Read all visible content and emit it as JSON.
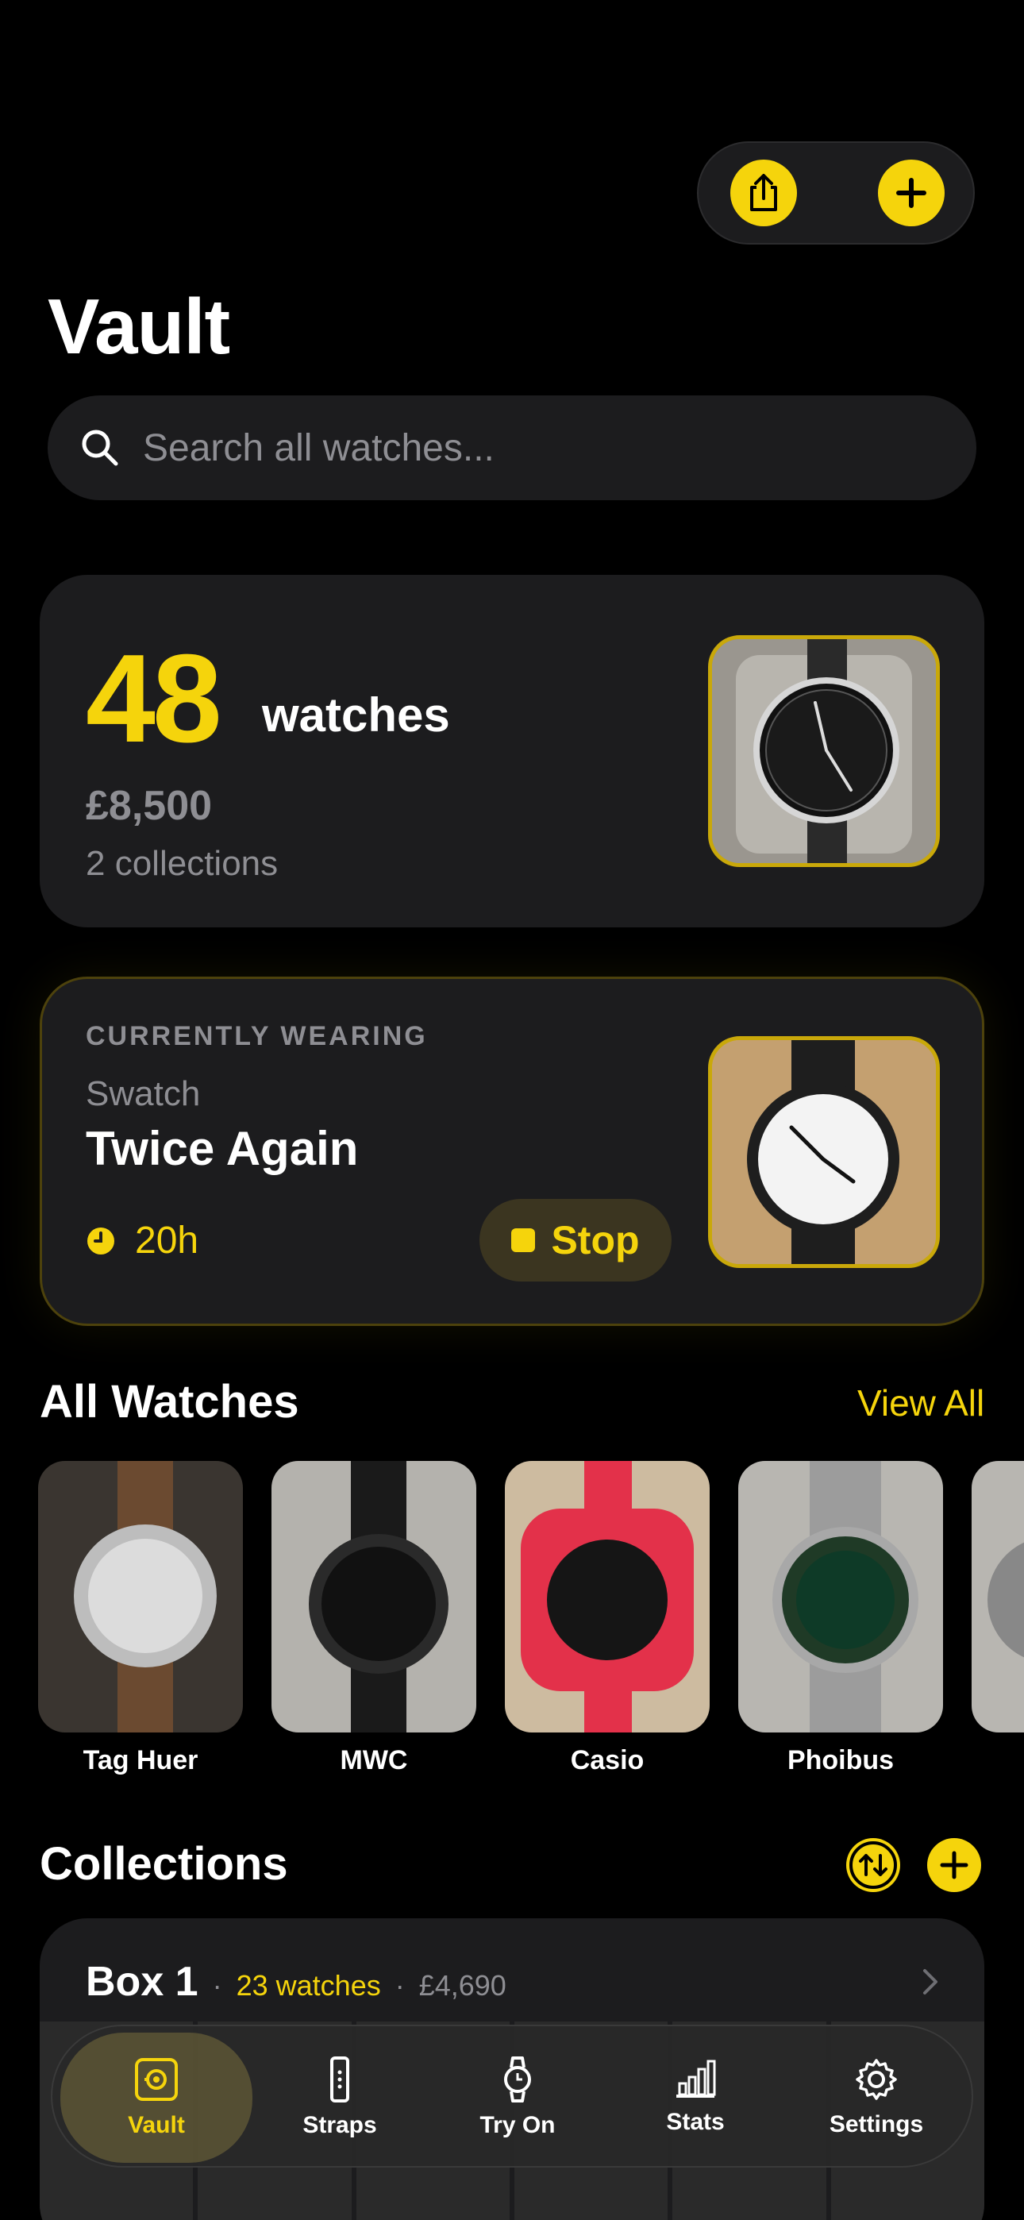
{
  "header": {
    "title": "Vault",
    "share_icon": "share-icon",
    "add_icon": "plus-icon"
  },
  "search": {
    "placeholder": "Search all watches..."
  },
  "summary": {
    "count": "48",
    "count_label": "watches",
    "value": "£8,500",
    "collections": "2 collections"
  },
  "wearing": {
    "kicker": "CURRENTLY WEARING",
    "brand": "Swatch",
    "model": "Twice Again",
    "time": "20h",
    "stop_label": "Stop"
  },
  "all_watches": {
    "title": "All Watches",
    "view_all": "View All",
    "items": [
      {
        "name": "Tag Huer"
      },
      {
        "name": "MWC"
      },
      {
        "name": "Casio"
      },
      {
        "name": "Phoibus"
      }
    ]
  },
  "collections": {
    "title": "Collections",
    "items": [
      {
        "name": "Box 1",
        "count": "23 watches",
        "value": "£4,690",
        "separator": "·"
      }
    ]
  },
  "tabbar": {
    "items": [
      {
        "label": "Vault",
        "icon": "vault-icon",
        "active": true
      },
      {
        "label": "Straps",
        "icon": "strap-icon"
      },
      {
        "label": "Try On",
        "icon": "watch-icon"
      },
      {
        "label": "Stats",
        "icon": "bar-chart-icon"
      },
      {
        "label": "Settings",
        "icon": "gear-icon"
      }
    ]
  },
  "colors": {
    "accent": "#f5d40c",
    "background": "#000000",
    "card": "#1c1c1e",
    "muted": "#8e8e93"
  }
}
